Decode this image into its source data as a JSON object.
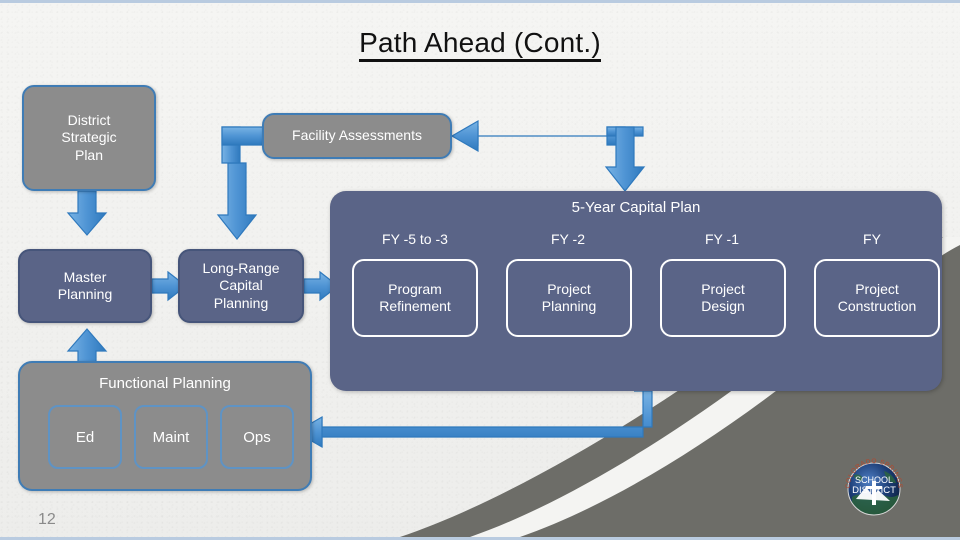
{
  "slide": {
    "title": "Path Ahead (Cont.)",
    "page_number": "12"
  },
  "nodes": {
    "district_strategic_plan": "District\nStrategic\nPlan",
    "district_strategic_plan_l1": "District",
    "district_strategic_plan_l2": "Strategic",
    "district_strategic_plan_l3": "Plan",
    "facility_assessments": "Facility Assessments",
    "master_planning_l1": "Master",
    "master_planning_l2": "Planning",
    "long_range_l1": "Long-Range",
    "long_range_l2": "Capital",
    "long_range_l3": "Planning"
  },
  "capital_plan": {
    "title": "5-Year Capital Plan",
    "fy_labels": [
      "FY -5 to -3",
      "FY -2",
      "FY -1",
      "FY"
    ],
    "stages": [
      {
        "line1": "Program",
        "line2": "Refinement"
      },
      {
        "line1": "Project",
        "line2": "Planning"
      },
      {
        "line1": "Project",
        "line2": "Design"
      },
      {
        "line1": "Project",
        "line2": "Construction"
      }
    ]
  },
  "functional_planning": {
    "title": "Functional Planning",
    "items": [
      "Ed",
      "Maint",
      "Ops"
    ]
  },
  "logo": {
    "arc_text": "COLORADO SPRINGS",
    "line1": "SCHOOL",
    "line2": "DISTRICT"
  },
  "colors": {
    "slate": "#5a6487",
    "gray": "#8c8c8c",
    "arrow_blue": "#4f94d4",
    "border_blue": "#3f7cb5",
    "background": "#f2f2f0"
  }
}
